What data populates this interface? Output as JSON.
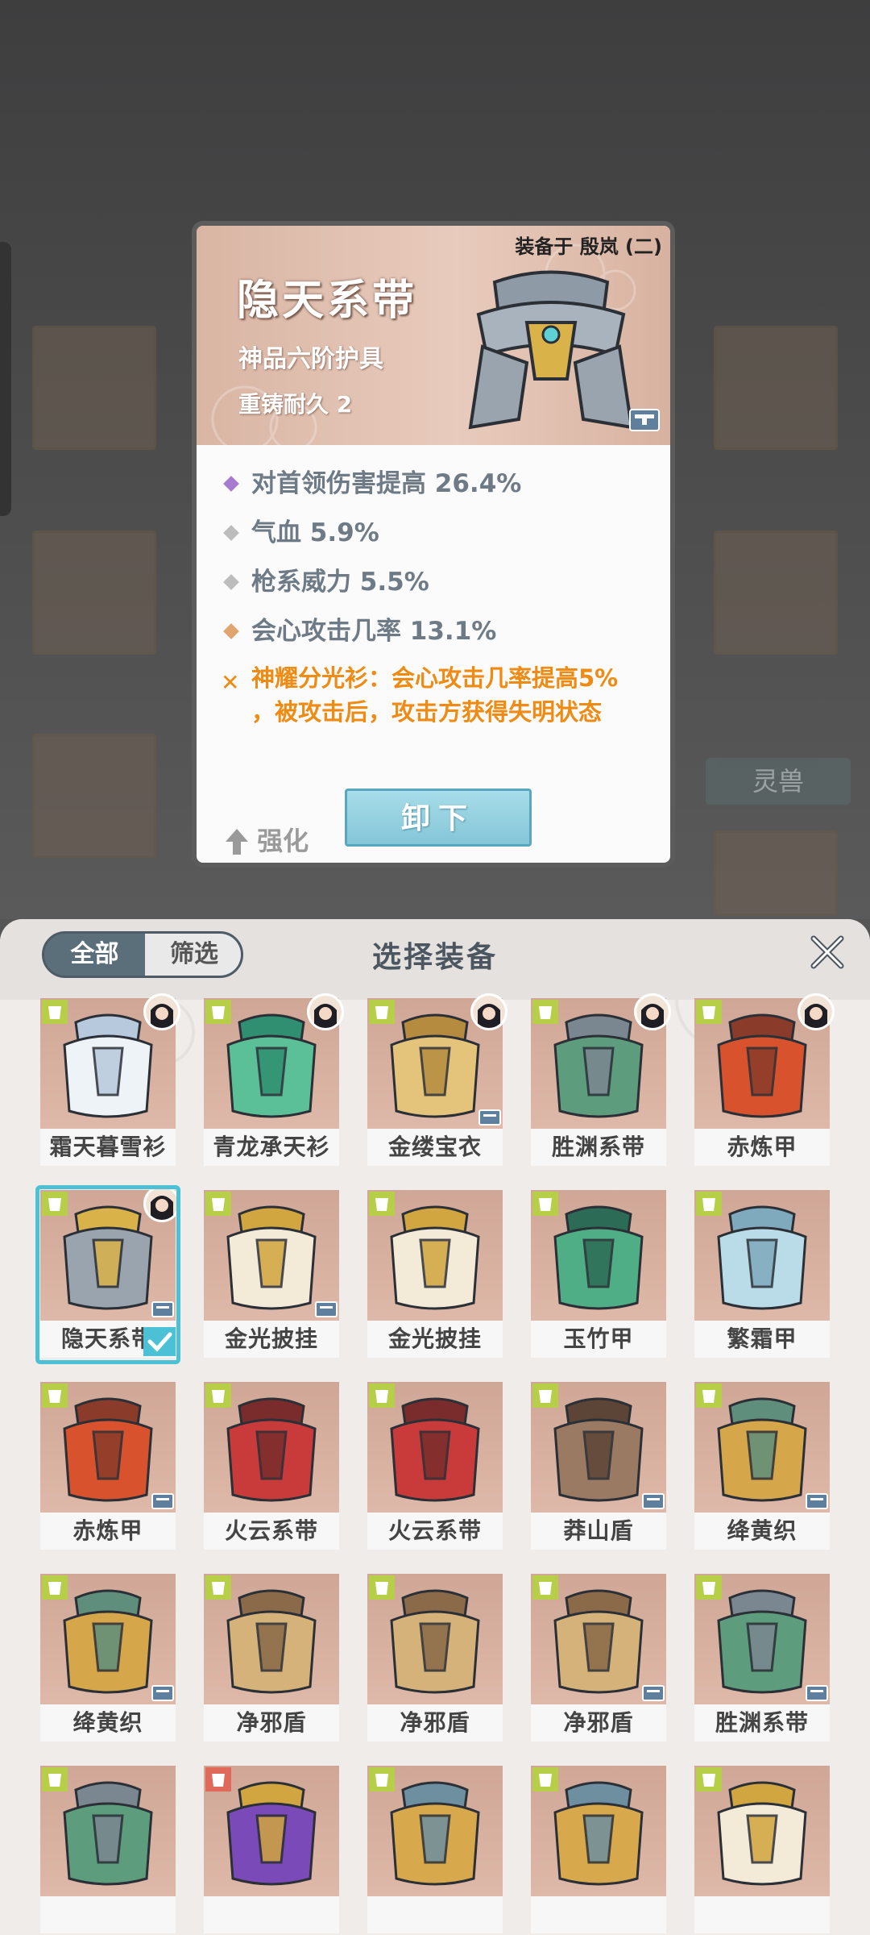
{
  "detail": {
    "equipped_on": "装备于 殷岚 (二)",
    "title": "隐天系带",
    "grade": "神品六阶护具",
    "durability": "重铸耐久 2",
    "stats": [
      {
        "text": "对首领伤害提高 26.4%",
        "color": "#a77bd0"
      },
      {
        "text": "气血 5.9%",
        "color": "#bdbdbd"
      },
      {
        "text": "枪系威力 5.5%",
        "color": "#bdbdbd"
      },
      {
        "text": "会心攻击几率 13.1%",
        "color": "#e0a46e"
      }
    ],
    "special_line1": "神耀分光衫：会心攻击几率提高5%",
    "special_line2": "，被攻击后，攻击方获得失明状态",
    "enhance_label": "强化",
    "unequip_label": "卸下"
  },
  "panel": {
    "tab_all": "全部",
    "tab_filter": "筛选",
    "title": "选择装备"
  },
  "background": {
    "lingshou_label": "灵兽"
  },
  "items": [
    {
      "name": "霜天暮雪衫",
      "type": "armor",
      "avatar": true,
      "chest": false,
      "art": "robe-white"
    },
    {
      "name": "青龙承天衫",
      "type": "armor",
      "avatar": true,
      "chest": false,
      "art": "robe-green"
    },
    {
      "name": "金缕宝衣",
      "type": "armor",
      "avatar": true,
      "chest": true,
      "art": "robe-gold"
    },
    {
      "name": "胜渊系带",
      "type": "belt",
      "avatar": true,
      "chest": false,
      "art": "belt-green"
    },
    {
      "name": "赤炼甲",
      "type": "armor",
      "avatar": true,
      "chest": false,
      "art": "armor-red"
    },
    {
      "name": "隐天系带",
      "type": "belt",
      "avatar": true,
      "chest": true,
      "art": "belt-grey",
      "selected": true
    },
    {
      "name": "金光披挂",
      "type": "armor",
      "avatar": false,
      "chest": true,
      "art": "cape-gold"
    },
    {
      "name": "金光披挂",
      "type": "armor",
      "avatar": false,
      "chest": false,
      "art": "cape-gold"
    },
    {
      "name": "玉竹甲",
      "type": "armor",
      "avatar": false,
      "chest": false,
      "art": "armor-jade"
    },
    {
      "name": "繁霜甲",
      "type": "armor",
      "avatar": false,
      "chest": false,
      "art": "armor-ice"
    },
    {
      "name": "赤炼甲",
      "type": "armor",
      "avatar": false,
      "chest": true,
      "art": "armor-red"
    },
    {
      "name": "火云系带",
      "type": "belt",
      "avatar": false,
      "chest": false,
      "art": "belt-red"
    },
    {
      "name": "火云系带",
      "type": "belt",
      "avatar": false,
      "chest": false,
      "art": "belt-red"
    },
    {
      "name": "莽山盾",
      "type": "armor",
      "avatar": false,
      "chest": true,
      "art": "shield-bronze"
    },
    {
      "name": "绛黄织",
      "type": "armor",
      "avatar": false,
      "chest": true,
      "art": "cloth-yellow"
    },
    {
      "name": "绛黄织",
      "type": "armor",
      "avatar": false,
      "chest": true,
      "art": "cloth-yellow"
    },
    {
      "name": "净邪盾",
      "type": "armor",
      "avatar": false,
      "chest": false,
      "art": "shield-gold"
    },
    {
      "name": "净邪盾",
      "type": "armor",
      "avatar": false,
      "chest": false,
      "art": "shield-gold"
    },
    {
      "name": "净邪盾",
      "type": "armor",
      "avatar": false,
      "chest": true,
      "art": "shield-gold"
    },
    {
      "name": "胜渊系带",
      "type": "belt",
      "avatar": false,
      "chest": true,
      "art": "belt-green"
    },
    {
      "name": "",
      "type": "armor",
      "avatar": false,
      "chest": false,
      "art": "belt-green"
    },
    {
      "name": "",
      "type": "armor-red",
      "avatar": false,
      "chest": false,
      "art": "armor-purple"
    },
    {
      "name": "",
      "type": "armor",
      "avatar": false,
      "chest": false,
      "art": "vest-gold"
    },
    {
      "name": "",
      "type": "armor",
      "avatar": false,
      "chest": false,
      "art": "vest-gold"
    },
    {
      "name": "",
      "type": "armor",
      "avatar": false,
      "chest": false,
      "art": "cape-gold"
    }
  ]
}
